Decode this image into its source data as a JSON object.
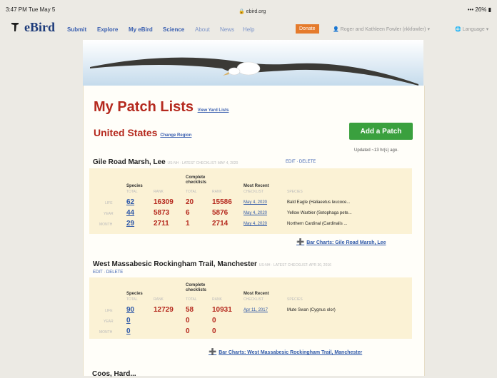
{
  "status_bar": {
    "time": "3:47 PM  Tue May 5",
    "url": "ebird.org",
    "battery": "26%"
  },
  "nav": {
    "logo": "eBird",
    "items": [
      "Submit",
      "Explore",
      "My eBird",
      "Science",
      "About",
      "News",
      "Help"
    ],
    "donate": "Donate",
    "user": "Roger and Kathleen Fowler (rkkfowler) ▾",
    "language": "Language ▾"
  },
  "page": {
    "title": "My Patch Lists",
    "view_yard_lists": "View Yard Lists",
    "region": "United States",
    "change_region": "Change Region",
    "add_patch": "Add a Patch",
    "updated": "Updated ~13 hr(s) ago."
  },
  "table_headers": {
    "species": "Species",
    "complete_checklists": "Complete checklists",
    "most_recent": "Most Recent",
    "total": "TOTAL",
    "rank": "RANK",
    "checklist": "CHECKLIST",
    "species_col": "SPECIES",
    "row_life": "LIFE",
    "row_year": "YEAR",
    "row_month": "MONTH"
  },
  "patches": [
    {
      "name": "Gile Road Marsh, Lee",
      "meta": "US-NH · LATEST CHECKLIST: MAY 4, 2020",
      "edit": "EDIT",
      "delete": "DELETE",
      "rows": [
        {
          "species_total": "62",
          "species_rank": "16309",
          "cl_total": "20",
          "cl_rank": "15586",
          "date": "May 4, 2020",
          "bird": "Bald Eagle (Haliaeetus leucoce..."
        },
        {
          "species_total": "44",
          "species_rank": "5873",
          "cl_total": "6",
          "cl_rank": "5876",
          "date": "May 4, 2020",
          "bird": "Yellow Warbler (Setophaga pete..."
        },
        {
          "species_total": "29",
          "species_rank": "2711",
          "cl_total": "1",
          "cl_rank": "2714",
          "date": "May 4, 2020",
          "bird": "Northern Cardinal (Cardinalis ..."
        }
      ],
      "bar_chart": "Bar Charts: Gile Road Marsh, Lee"
    },
    {
      "name": "West Massabesic Rockingham Trail, Manchester",
      "meta": "US-NH · LATEST CHECKLIST: APR 30, 2016",
      "edit": "EDIT",
      "delete": "DELETE",
      "rows": [
        {
          "species_total": "90",
          "species_rank": "12729",
          "cl_total": "58",
          "cl_rank": "10931",
          "date": "Apr 11, 2017",
          "bird": "Mute Swan (Cygnus olor)"
        },
        {
          "species_total": "0",
          "species_rank": "",
          "cl_total": "0",
          "cl_rank": "0",
          "date": "",
          "bird": ""
        },
        {
          "species_total": "0",
          "species_rank": "",
          "cl_total": "0",
          "cl_rank": "0",
          "date": "",
          "bird": ""
        }
      ],
      "bar_chart": "Bar Charts: West Massabesic Rockingham Trail, Manchester"
    }
  ],
  "bottom": {
    "next_section": "Coos, Hard..."
  },
  "colors": {
    "accent_red": "#b5291e",
    "link_blue": "#2e58a8",
    "add_green": "#3aa03e",
    "donate_orange": "#e57b2c",
    "stats_bg": "#fbf2d5"
  }
}
